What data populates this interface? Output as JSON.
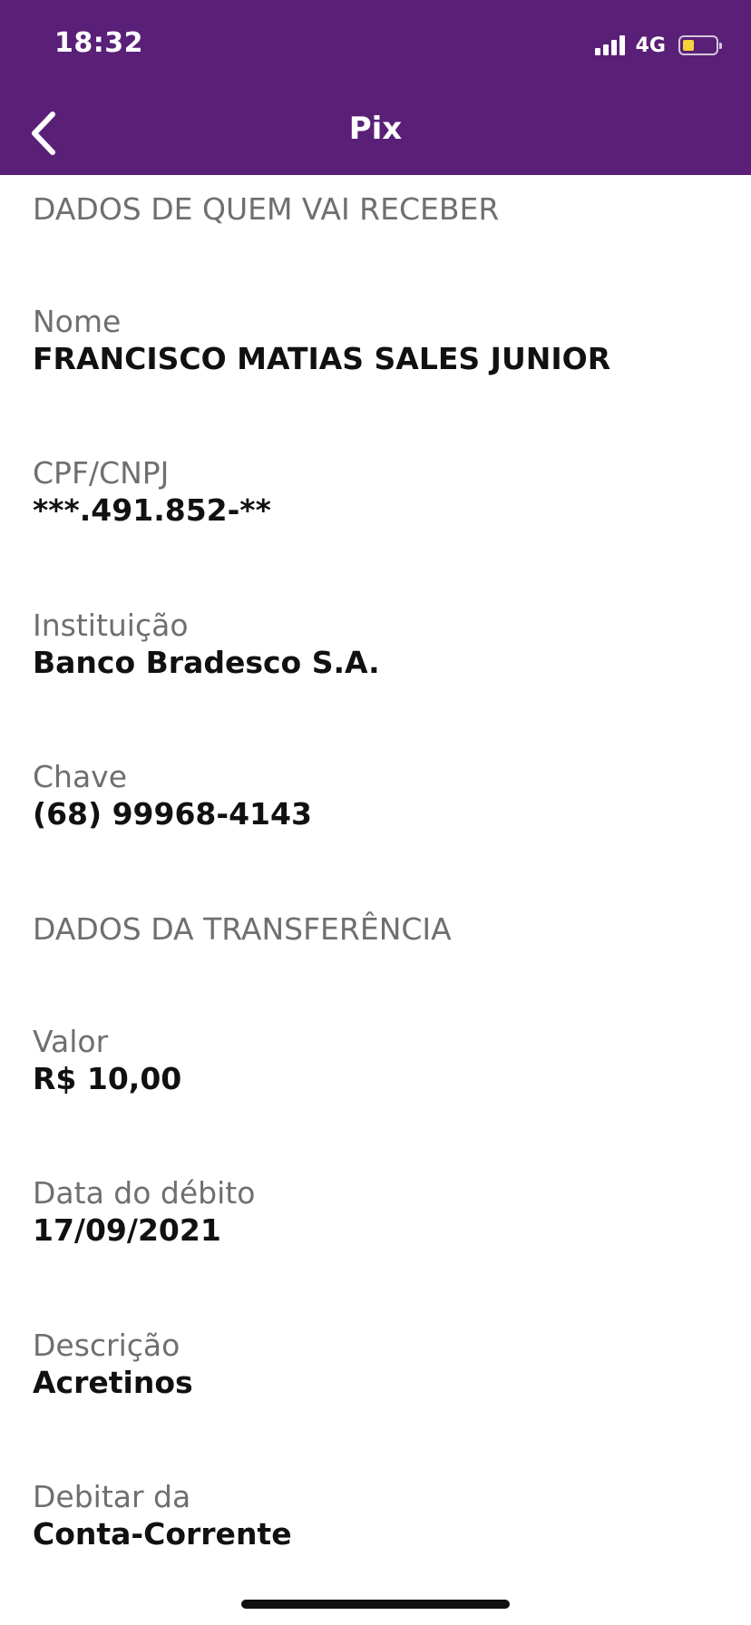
{
  "status_bar": {
    "time": "18:32",
    "network": "4G",
    "signal_bars": 4,
    "battery_level": 0.35,
    "battery_color": "#f5d33b"
  },
  "header": {
    "title": "Pix",
    "background_color": "#5a2077",
    "back_icon": "chevron-left-icon"
  },
  "receiver": {
    "section_title": "DADOS DE QUEM VAI RECEBER",
    "fields": [
      {
        "label": "Nome",
        "value": "FRANCISCO MATIAS SALES JUNIOR"
      },
      {
        "label": "CPF/CNPJ",
        "value": "***.491.852-**"
      },
      {
        "label": "Instituição",
        "value": "Banco Bradesco S.A."
      },
      {
        "label": "Chave",
        "value": "(68) 99968-4143"
      }
    ]
  },
  "transfer": {
    "section_title": "DADOS DA TRANSFERÊNCIA",
    "fields": [
      {
        "label": "Valor",
        "value": "R$ 10,00"
      },
      {
        "label": "Data do débito",
        "value": "17/09/2021"
      },
      {
        "label": "Descrição",
        "value": "Acretinos"
      },
      {
        "label": "Debitar da",
        "value": "Conta-Corrente"
      }
    ]
  }
}
